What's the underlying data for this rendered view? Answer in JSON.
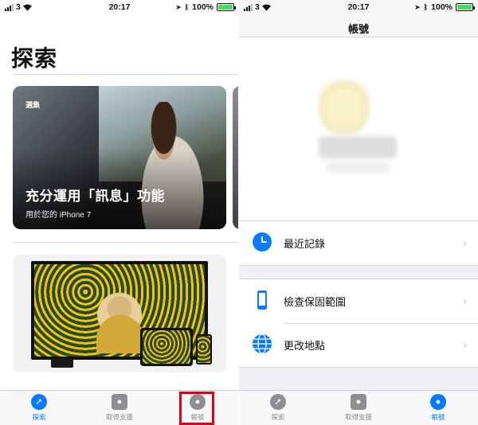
{
  "colors": {
    "accent": "#0a7aff",
    "highlight": "#e0001b",
    "battery": "#4cd964"
  },
  "status_left": {
    "carrier": "3",
    "time": "20:17",
    "battery": "100%"
  },
  "status_right": {
    "carrier": "3",
    "time": "20:17",
    "battery": "100%"
  },
  "explore": {
    "title": "探索",
    "featured": {
      "kicker": "選集",
      "title": "充分運用「訊息」功能",
      "subtitle": "用於您的 iPhone 7"
    },
    "section_label": "文章"
  },
  "tabs_left": [
    {
      "label": "探索",
      "icon": "compass-icon",
      "active": true
    },
    {
      "label": "取得支援",
      "icon": "apple-support-icon",
      "active": false
    },
    {
      "label": "帳號",
      "icon": "account-icon",
      "active": false
    }
  ],
  "account": {
    "title": "帳號",
    "rows": [
      {
        "label": "最近記錄",
        "icon": "clock-icon"
      },
      {
        "label": "檢查保固範圍",
        "icon": "iphone-icon"
      },
      {
        "label": "更改地點",
        "icon": "globe-icon"
      }
    ]
  },
  "tabs_right": [
    {
      "label": "探索",
      "icon": "compass-icon",
      "active": false
    },
    {
      "label": "取得支援",
      "icon": "apple-support-icon",
      "active": false
    },
    {
      "label": "帳號",
      "icon": "account-icon",
      "active": true
    }
  ]
}
